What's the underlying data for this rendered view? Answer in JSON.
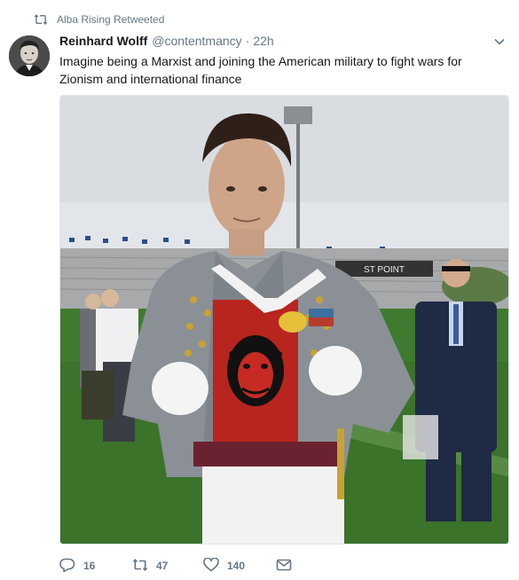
{
  "context": {
    "retweeted_by": "Alba Rising Retweeted"
  },
  "tweet": {
    "author_name": "Reinhard Wolff",
    "author_handle": "@contentmancy",
    "separator": "·",
    "time": "22h",
    "text": "Imagine being a Marxist and joining the American military to fight wars for Zionism and international finance"
  },
  "media": {
    "stadium_sign": "ST POINT"
  },
  "actions": {
    "reply_count": "16",
    "retweet_count": "47",
    "like_count": "140"
  },
  "colors": {
    "text": "#14171a",
    "secondary": "#657786",
    "border": "#e1e8ed"
  },
  "icons": {
    "context": "retweet-icon",
    "reply": "reply-icon",
    "retweet": "retweet-icon",
    "like": "heart-icon",
    "dm": "envelope-icon",
    "menu": "chevron-down-icon"
  }
}
